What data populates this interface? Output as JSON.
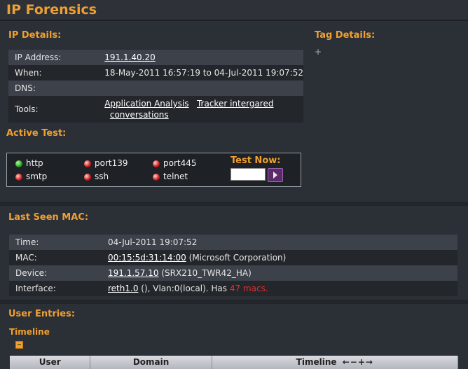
{
  "page": {
    "title": "IP Forensics"
  },
  "ip_details": {
    "heading": "IP Details:",
    "rows": [
      {
        "label": "IP Address:",
        "value": "191.1.40.20"
      },
      {
        "label": "When:",
        "value": "18-May-2011 16:57:19 to 04-Jul-2011 19:07:52"
      },
      {
        "label": "DNS:",
        "value": ""
      },
      {
        "label": "Tools:",
        "link1": "Application Analysis",
        "link2": "Tracker intergared",
        "link3": "conversations"
      }
    ]
  },
  "tag_details": {
    "heading": "Tag Details:",
    "add_glyph": "+"
  },
  "active_test": {
    "heading": "Active Test:",
    "services": [
      {
        "name": "http",
        "status": "up"
      },
      {
        "name": "smtp",
        "status": "down"
      },
      {
        "name": "port139",
        "status": "down"
      },
      {
        "name": "ssh",
        "status": "down"
      },
      {
        "name": "port445",
        "status": "down"
      },
      {
        "name": "telnet",
        "status": "down"
      }
    ],
    "test_now_label": "Test Now:",
    "test_input_value": "",
    "colors": {
      "up": "#22a31e",
      "down": "#d01818"
    }
  },
  "last_seen_mac": {
    "heading": "Last Seen MAC:",
    "rows": [
      {
        "label": "Time:",
        "value": "04-Jul-2011 19:07:52"
      },
      {
        "label": "MAC:",
        "link": "00:15:5d:31:14:00",
        "suffix": " (Microsoft Corporation)"
      },
      {
        "label": "Device:",
        "link": "191.1.57.10",
        "suffix": " (SRX210_TWR42_HA)"
      },
      {
        "label": "Interface:",
        "link": "reth1.0",
        "suffix": " (), Vlan:0(local). Has ",
        "highlight": "47 macs."
      }
    ]
  },
  "user_entries": {
    "heading": "User Entries:",
    "timeline_heading": "Timeline",
    "collapse_icon": "minus-square-icon",
    "columns": [
      "User",
      "Domain",
      "Timeline"
    ],
    "timeline_controls": "←−+→"
  },
  "colors": {
    "accent": "#f0a030",
    "background": "#2b2f36",
    "alert": "#e03030"
  }
}
